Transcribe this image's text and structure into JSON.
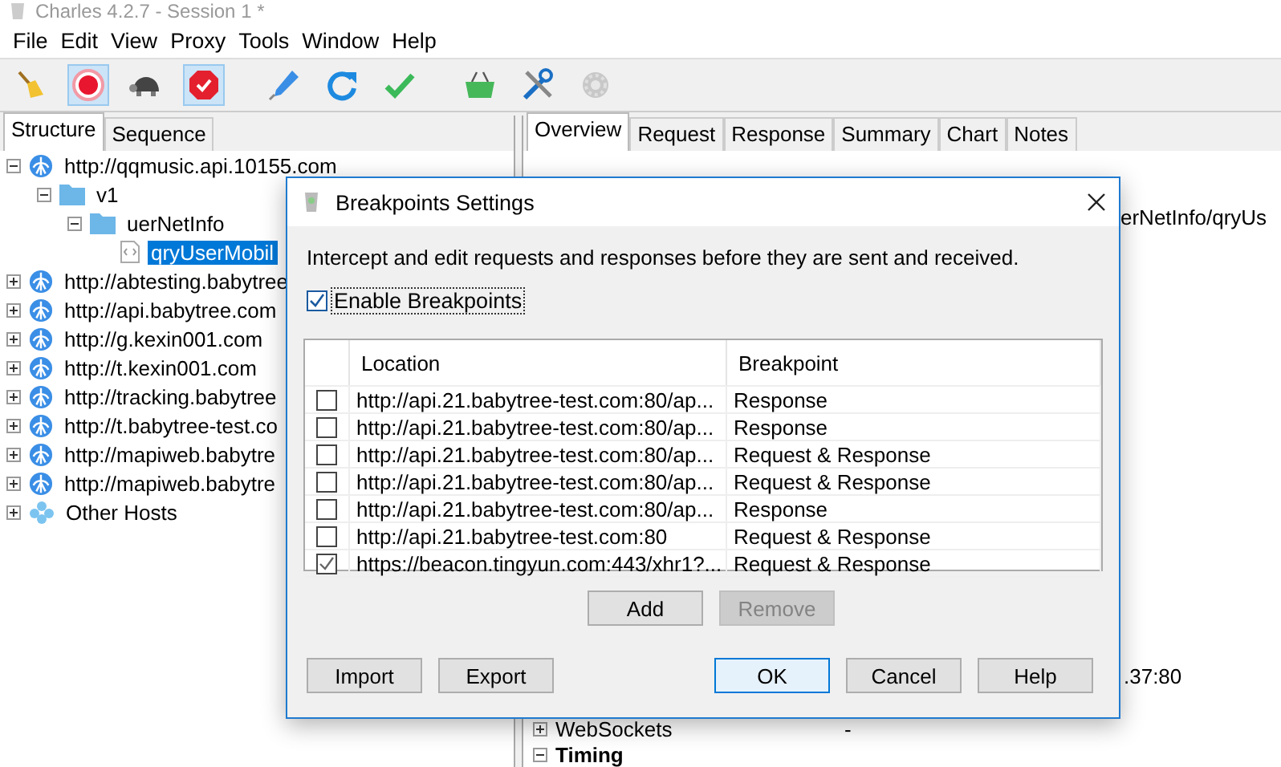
{
  "window": {
    "title": "Charles 4.2.7 - Session 1 *"
  },
  "menu": [
    "File",
    "Edit",
    "View",
    "Proxy",
    "Tools",
    "Window",
    "Help"
  ],
  "toolbar": [
    {
      "kind": "broom",
      "selected": false,
      "disabled": false
    },
    {
      "kind": "record",
      "selected": true,
      "disabled": false
    },
    {
      "kind": "turtle",
      "selected": false,
      "disabled": false
    },
    {
      "kind": "breakpoint",
      "selected": true,
      "disabled": false
    },
    {
      "kind": "pen",
      "selected": false,
      "disabled": false
    },
    {
      "kind": "refresh",
      "selected": false,
      "disabled": false
    },
    {
      "kind": "check",
      "selected": false,
      "disabled": false
    },
    {
      "kind": "basket",
      "selected": false,
      "disabled": false
    },
    {
      "kind": "tools",
      "selected": false,
      "disabled": false
    },
    {
      "kind": "gear",
      "selected": false,
      "disabled": true
    }
  ],
  "left_tabs": [
    {
      "label": "Structure",
      "selected": true
    },
    {
      "label": "Sequence",
      "selected": false
    }
  ],
  "tree": [
    {
      "label": "http://qqmusic.api.10155.com",
      "kind": "host",
      "expanded": true,
      "selected": false,
      "children": [
        {
          "label": "v1",
          "kind": "folder",
          "expanded": true,
          "selected": false,
          "children": [
            {
              "label": "uerNetInfo",
              "kind": "folder",
              "expanded": true,
              "selected": false,
              "children": [
                {
                  "label": "qryUserMobil",
                  "kind": "file",
                  "selected": true
                }
              ]
            }
          ]
        }
      ]
    },
    {
      "label": "http://abtesting.babytree",
      "kind": "host",
      "expanded": false,
      "selected": false
    },
    {
      "label": "http://api.babytree.com",
      "kind": "host",
      "expanded": false,
      "selected": false
    },
    {
      "label": "http://g.kexin001.com",
      "kind": "host",
      "expanded": false,
      "selected": false
    },
    {
      "label": "http://t.kexin001.com",
      "kind": "host",
      "expanded": false,
      "selected": false
    },
    {
      "label": "http://tracking.babytree",
      "kind": "host",
      "expanded": false,
      "selected": false
    },
    {
      "label": "http://t.babytree-test.co",
      "kind": "host",
      "expanded": false,
      "selected": false
    },
    {
      "label": "http://mapiweb.babytre",
      "kind": "host",
      "expanded": false,
      "selected": false
    },
    {
      "label": "http://mapiweb.babytre",
      "kind": "host",
      "expanded": false,
      "selected": false
    },
    {
      "label": "Other Hosts",
      "kind": "group",
      "expanded": false,
      "selected": false
    }
  ],
  "right_tabs": [
    {
      "label": "Overview",
      "selected": true
    },
    {
      "label": "Request",
      "selected": false
    },
    {
      "label": "Response",
      "selected": false
    },
    {
      "label": "Summary",
      "selected": false
    },
    {
      "label": "Chart",
      "selected": false
    },
    {
      "label": "Notes",
      "selected": false
    }
  ],
  "overview": {
    "path_value": "erNetInfo/qryUs",
    "address_value": ".37:80",
    "sections": [
      {
        "name": "WebSockets",
        "expanded": false,
        "value": "-"
      },
      {
        "name": "Timing",
        "expanded": true
      }
    ]
  },
  "dialog": {
    "title": "Breakpoints Settings",
    "description": "Intercept and edit requests and responses before they are sent and received.",
    "enable": {
      "label": "Enable Breakpoints",
      "checked": true
    },
    "columns": [
      "Location",
      "Breakpoint"
    ],
    "rows": [
      {
        "enabled": false,
        "location": "http://api.21.babytree-test.com:80/ap...",
        "breakpoint": "Response"
      },
      {
        "enabled": false,
        "location": "http://api.21.babytree-test.com:80/ap...",
        "breakpoint": "Response"
      },
      {
        "enabled": false,
        "location": "http://api.21.babytree-test.com:80/ap...",
        "breakpoint": "Request & Response"
      },
      {
        "enabled": false,
        "location": "http://api.21.babytree-test.com:80/ap...",
        "breakpoint": "Request & Response"
      },
      {
        "enabled": false,
        "location": "http://api.21.babytree-test.com:80/ap...",
        "breakpoint": "Response"
      },
      {
        "enabled": false,
        "location": "http://api.21.babytree-test.com:80",
        "breakpoint": "Request & Response"
      },
      {
        "enabled": true,
        "location": "https://beacon.tingyun.com:443/xhr1?...",
        "breakpoint": "Request & Response"
      }
    ],
    "table_buttons": [
      {
        "label": "Add",
        "disabled": false
      },
      {
        "label": "Remove",
        "disabled": true
      }
    ],
    "left_buttons": [
      {
        "label": "Import",
        "focused": false
      },
      {
        "label": "Export",
        "focused": false
      }
    ],
    "right_buttons": [
      {
        "label": "OK",
        "focused": true
      },
      {
        "label": "Cancel",
        "focused": false
      },
      {
        "label": "Help",
        "focused": false
      }
    ]
  }
}
